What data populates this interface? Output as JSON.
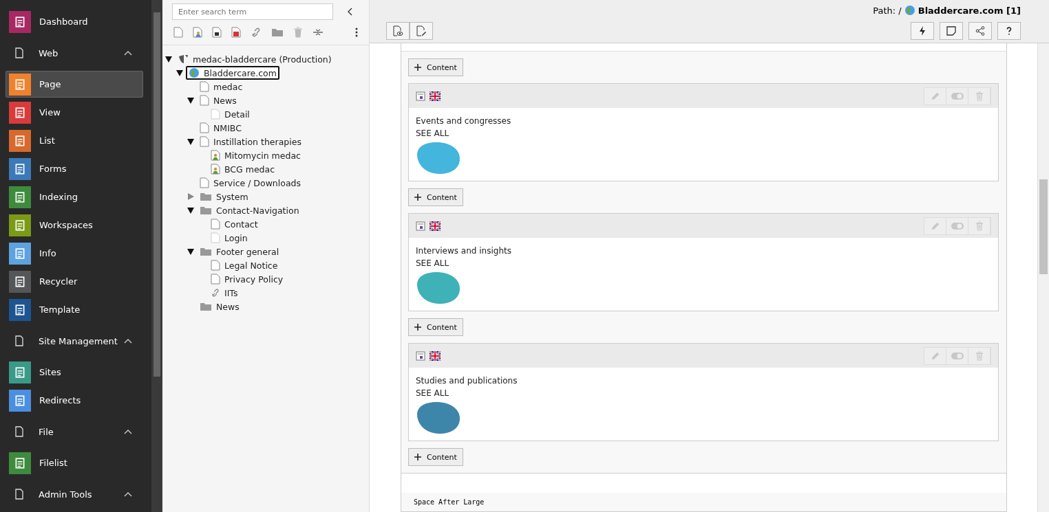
{
  "modules": [
    {
      "kind": "item",
      "label": "Dashboard",
      "color": "#a82863",
      "selected": false
    },
    {
      "kind": "group",
      "label": "Web",
      "expanded": true
    },
    {
      "kind": "item",
      "label": "Page",
      "color": "#f0822d",
      "selected": true
    },
    {
      "kind": "item",
      "label": "View",
      "color": "#d93b3b",
      "selected": false
    },
    {
      "kind": "item",
      "label": "List",
      "color": "#d8692c",
      "selected": false
    },
    {
      "kind": "item",
      "label": "Forms",
      "color": "#3b7ab8",
      "selected": false
    },
    {
      "kind": "item",
      "label": "Indexing",
      "color": "#3e8b3e",
      "selected": false
    },
    {
      "kind": "item",
      "label": "Workspaces",
      "color": "#7b9a16",
      "selected": false
    },
    {
      "kind": "item",
      "label": "Info",
      "color": "#5ea2e0",
      "selected": false
    },
    {
      "kind": "item",
      "label": "Recycler",
      "color": "#545658",
      "selected": false
    },
    {
      "kind": "item",
      "label": "Template",
      "color": "#1d5592",
      "selected": false
    },
    {
      "kind": "group",
      "label": "Site Management",
      "expanded": true
    },
    {
      "kind": "item",
      "label": "Sites",
      "color": "#3a9a88",
      "selected": false
    },
    {
      "kind": "item",
      "label": "Redirects",
      "color": "#4b8fe0",
      "selected": false
    },
    {
      "kind": "group",
      "label": "File",
      "expanded": true
    },
    {
      "kind": "item",
      "label": "Filelist",
      "color": "#3e8b3e",
      "selected": false
    },
    {
      "kind": "group",
      "label": "Admin Tools",
      "expanded": true
    }
  ],
  "tree_search": {
    "placeholder": "Enter search term"
  },
  "tree": [
    {
      "label": "medac-bladdercare (Production)",
      "kind": "root",
      "expanded": true,
      "selected": false,
      "children": [
        {
          "label": "Bladdercare.com",
          "kind": "site",
          "expanded": true,
          "selected": true,
          "children": [
            {
              "label": "medac",
              "kind": "page",
              "selected": false
            },
            {
              "label": "News",
              "kind": "page",
              "expanded": true,
              "selected": false,
              "children": [
                {
                  "label": "Detail",
                  "kind": "hidden",
                  "selected": false
                }
              ]
            },
            {
              "label": "NMIBC",
              "kind": "page",
              "selected": false
            },
            {
              "label": "Instillation therapies",
              "kind": "page",
              "expanded": true,
              "selected": false,
              "children": [
                {
                  "label": "Mitomycin medac",
                  "kind": "user",
                  "selected": false
                },
                {
                  "label": "BCG medac",
                  "kind": "user",
                  "selected": false
                }
              ]
            },
            {
              "label": "Service / Downloads",
              "kind": "page",
              "selected": false
            },
            {
              "label": "System",
              "kind": "folder",
              "expanded": false,
              "selected": false
            },
            {
              "label": "Contact-Navigation",
              "kind": "folder",
              "expanded": true,
              "selected": false,
              "children": [
                {
                  "label": "Contact",
                  "kind": "page",
                  "selected": false
                },
                {
                  "label": "Login",
                  "kind": "hidden",
                  "selected": false
                }
              ]
            },
            {
              "label": "Footer general",
              "kind": "folder",
              "expanded": true,
              "selected": false,
              "children": [
                {
                  "label": "Legal Notice",
                  "kind": "page",
                  "selected": false
                },
                {
                  "label": "Privacy Policy",
                  "kind": "page",
                  "selected": false
                },
                {
                  "label": "IITs",
                  "kind": "link",
                  "selected": false
                }
              ]
            },
            {
              "label": "News",
              "kind": "folder",
              "selected": false
            }
          ]
        }
      ]
    }
  ],
  "path": {
    "label": "Path: /",
    "page": "Bladdercare.com [1]"
  },
  "add_buttons": [
    "Content",
    "Content",
    "Content",
    "Content"
  ],
  "elements": [
    {
      "title": "Events and congresses",
      "link": "SEE ALL",
      "color": "#44b5dc"
    },
    {
      "title": "Interviews and insights",
      "link": "SEE ALL",
      "color": "#3eb2b6"
    },
    {
      "title": "Studies and publications",
      "link": "SEE ALL",
      "color": "#3d86aa"
    }
  ],
  "footer_label": "Space After Large"
}
